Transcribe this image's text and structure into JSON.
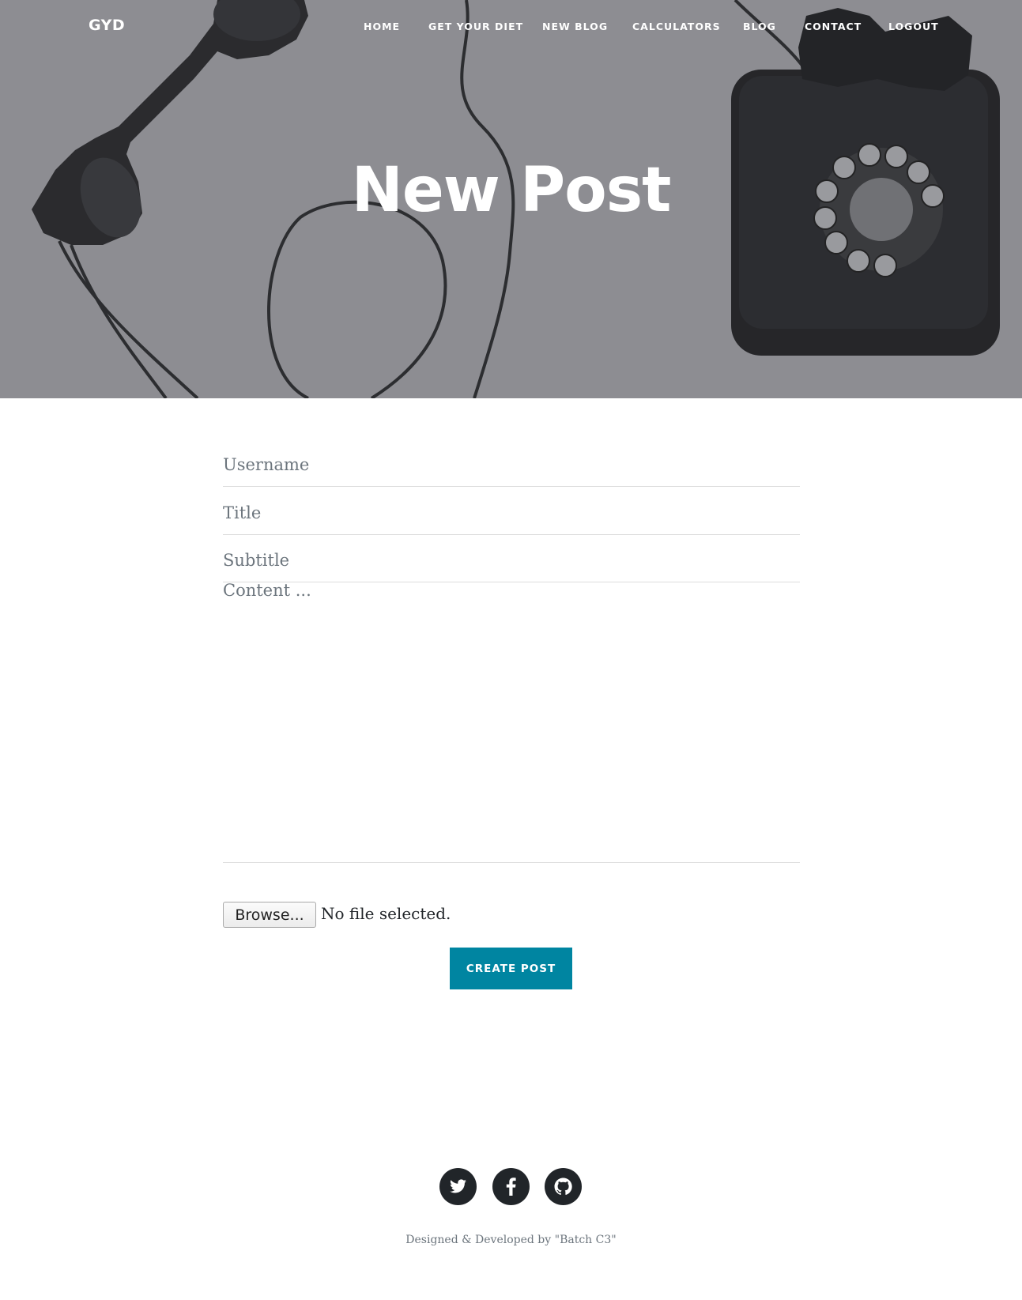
{
  "nav": {
    "brand": "GYD",
    "items": [
      {
        "label": "HOME"
      },
      {
        "label": "GET YOUR DIET"
      },
      {
        "label": "NEW BLOG"
      },
      {
        "label": "CALCULATORS"
      },
      {
        "label": "BLOG"
      },
      {
        "label": "CONTACT"
      },
      {
        "label": "LOGOUT"
      }
    ]
  },
  "header": {
    "title": "New Post"
  },
  "form": {
    "username_placeholder": "Username",
    "title_placeholder": "Title",
    "subtitle_placeholder": "Subtitle",
    "content_placeholder": "Content ...",
    "browse_label": "Browse...",
    "file_status": "No file selected.",
    "submit_label": "CREATE POST"
  },
  "footer": {
    "social": [
      {
        "icon": "twitter-icon"
      },
      {
        "icon": "facebook-icon"
      },
      {
        "icon": "github-icon"
      }
    ],
    "credit": "Designed & Developed by \"Batch C3\""
  },
  "colors": {
    "accent": "#0085a1",
    "hero_overlay": "#8d8e92",
    "social_bg": "#212529"
  }
}
